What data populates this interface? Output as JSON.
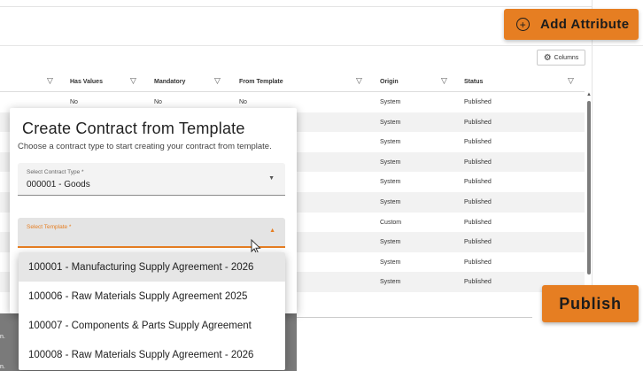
{
  "toolbar": {
    "add_attribute_label": "Add Attribute",
    "columns_label": "Columns",
    "publish_label": "Publish"
  },
  "table": {
    "headers": [
      "Has Values",
      "Mandatory",
      "From Template",
      "Origin",
      "Status"
    ],
    "rows": [
      {
        "has_values": "No",
        "mandatory": "No",
        "from_template": "No",
        "origin": "System",
        "status": "Published"
      },
      {
        "origin": "System",
        "status": "Published"
      },
      {
        "origin": "System",
        "status": "Published"
      },
      {
        "origin": "System",
        "status": "Published"
      },
      {
        "origin": "System",
        "status": "Published"
      },
      {
        "origin": "System",
        "status": "Published"
      },
      {
        "origin": "Custom",
        "status": "Published"
      },
      {
        "origin": "System",
        "status": "Published"
      },
      {
        "origin": "System",
        "status": "Published"
      },
      {
        "origin": "System",
        "status": "Published"
      }
    ]
  },
  "dialog": {
    "title": "Create Contract from Template",
    "subtitle": "Choose a contract type to start creating your contract from template.",
    "contract_type": {
      "label": "Select Contract Type *",
      "value": "000001 - Goods"
    },
    "template": {
      "label": "Select Template *",
      "options": [
        "100001 - Manufacturing Supply Agreement - 2026",
        "100006 - Raw Materials Supply Agreement 2025",
        "100007 - Components & Parts Supply Agreement",
        "100008 - Raw Materials Supply Agreement - 2026"
      ]
    }
  },
  "background": {
    "fragment_1": "n.",
    "fragment_2": "n."
  },
  "colors": {
    "accent": "#e67e22",
    "row_alt": "#f2f2f2",
    "menu_highlight": "#e6e6e6"
  },
  "icons": [
    "plus-circle-icon",
    "gear-icon",
    "filter-icon",
    "chevron-down-icon",
    "chevron-up-icon",
    "mouse-cursor-icon"
  ]
}
